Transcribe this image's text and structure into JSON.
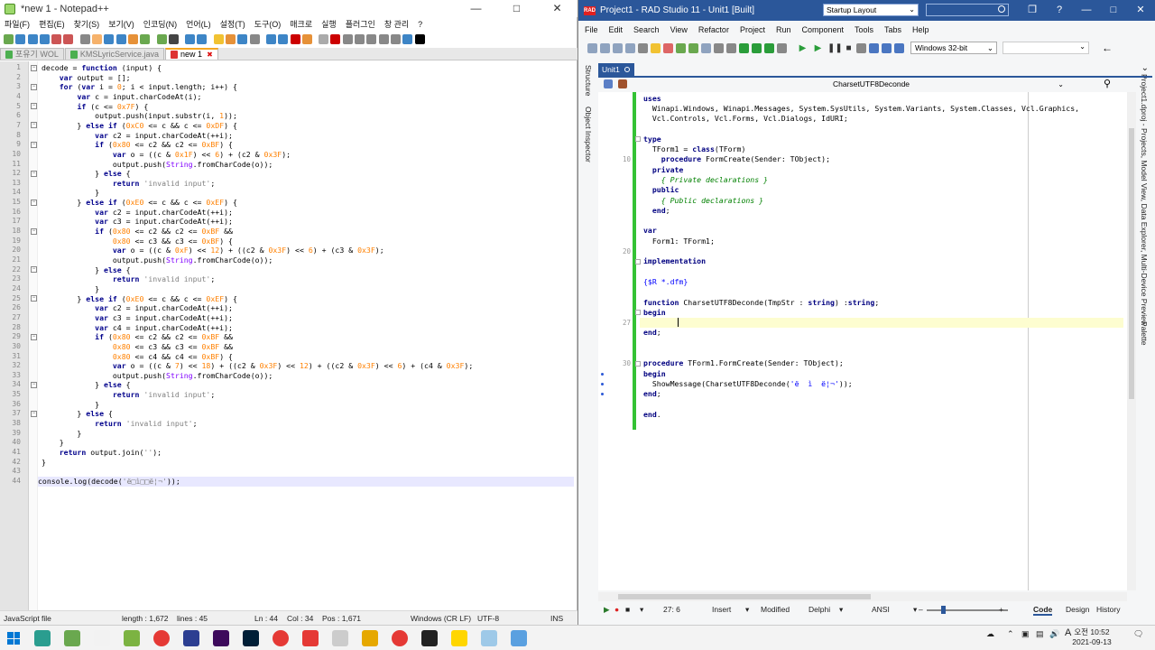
{
  "npp": {
    "title": "*new 1 - Notepad++",
    "menu": [
      "파일(F)",
      "편집(E)",
      "찾기(S)",
      "보기(V)",
      "인코딩(N)",
      "언어(L)",
      "설정(T)",
      "도구(O)",
      "매크로",
      "실행",
      "플러그인",
      "창 관리",
      "?"
    ],
    "tabs": [
      {
        "label": "포유기 WOL",
        "color": "#4caf50"
      },
      {
        "label": "KMSLyricService.java",
        "color": "#4caf50"
      },
      {
        "label": "new 1",
        "color": "#d33",
        "active": true
      }
    ],
    "code": [
      "decode = function (input) {",
      "    var output = [];",
      "    for (var i = 0; i < input.length; i++) {",
      "        var c = input.charCodeAt(i);",
      "        if (c <= 0x7F) {",
      "            output.push(input.substr(i, 1));",
      "        } else if (0xC0 <= c && c <= 0xDF) {",
      "            var c2 = input.charCodeAt(++i);",
      "            if (0x80 <= c2 && c2 <= 0xBF) {",
      "                var o = ((c & 0x1F) << 6) + (c2 & 0x3F);",
      "                output.push(String.fromCharCode(o));",
      "            } else {",
      "                return 'invalid input';",
      "            }",
      "        } else if (0xE0 <= c && c <= 0xEF) {",
      "            var c2 = input.charCodeAt(++i);",
      "            var c3 = input.charCodeAt(++i);",
      "            if (0x80 <= c2 && c2 <= 0xBF &&",
      "                0x80 <= c3 && c3 <= 0xBF) {",
      "                var o = ((c & 0xF) << 12) + ((c2 & 0x3F) << 6) + (c3 & 0x3F);",
      "                output.push(String.fromCharCode(o));",
      "            } else {",
      "                return 'invalid input';",
      "            }",
      "        } else if (0xE0 <= c && c <= 0xEF) {",
      "            var c2 = input.charCodeAt(++i);",
      "            var c3 = input.charCodeAt(++i);",
      "            var c4 = input.charCodeAt(++i);",
      "            if (0x80 <= c2 && c2 <= 0xBF &&",
      "                0x80 <= c3 && c3 <= 0xBF &&",
      "                0x80 <= c4 && c4 <= 0xBF) {",
      "                var o = ((c & 7) << 18) + ((c2 & 0x3F) << 12) + ((c2 & 0x3F) << 6) + (c4 & 0x3F);",
      "                output.push(String.fromCharCode(o));",
      "            } else {",
      "                return 'invalid input';",
      "            }",
      "        } else {",
      "            return 'invalid input';",
      "        }",
      "    }",
      "    return output.join('');",
      "}",
      "",
      "console.log(decode('ë□ì□□ë¦¬'));"
    ],
    "current_line": 44,
    "fold_lines": [
      1,
      3,
      5,
      7,
      9,
      12,
      15,
      18,
      22,
      25,
      29,
      34,
      37
    ],
    "status": {
      "lang": "JavaScript file",
      "length": "length : 1,672",
      "lines": "lines : 45",
      "ln": "Ln : 44",
      "col": "Col : 34",
      "pos": "Pos : 1,671",
      "eol": "Windows (CR LF)",
      "enc": "UTF-8",
      "ins": "INS"
    }
  },
  "rad": {
    "title": "Project1 - RAD Studio 11 - Unit1 [Built]",
    "layout": "Startup Layout",
    "menu": [
      "File",
      "Edit",
      "Search",
      "View",
      "Refactor",
      "Project",
      "Run",
      "Component",
      "Tools",
      "Tabs",
      "Help"
    ],
    "platform": "Windows 32-bit",
    "tab": "Unit1",
    "nav_selection": "CharsetUTF8Deconde",
    "side_left": [
      "Structure",
      "Object Inspector"
    ],
    "side_right": [
      "Project1.dproj - Projects, Model View, Data Explorer, Multi-Device Preview",
      "Palette"
    ],
    "code": [
      "uses",
      "  Winapi.Windows, Winapi.Messages, System.SysUtils, System.Variants, System.Classes, Vcl.Graphics,",
      "  Vcl.Controls, Vcl.Forms, Vcl.Dialogs, IdURI;",
      "",
      "type",
      "  TForm1 = class(TForm)",
      "    procedure FormCreate(Sender: TObject);",
      "  private",
      "    { Private declarations }",
      "  public",
      "    { Public declarations }",
      "  end;",
      "",
      "var",
      "  Form1: TForm1;",
      "",
      "implementation",
      "",
      "{$R *.dfm}",
      "",
      "function CharsetUTF8Deconde(TmpStr : string) :string;",
      "begin",
      "    |",
      "end;",
      "",
      "",
      "procedure TForm1.FormCreate(Sender: TObject);",
      "begin",
      "  ShowMessage(CharsetUTF8Deconde('ë  ì  ë¦¬'));",
      "end;",
      "",
      "end."
    ],
    "line_numbers": {
      "6": "10",
      "15": "20",
      "22": "27",
      "26": "30"
    },
    "dots": [
      28,
      29,
      30
    ],
    "folds": [
      4,
      16,
      21,
      26
    ],
    "status": {
      "pos": "27: 6",
      "mode": "Insert",
      "modified": "Modified",
      "lang": "Delphi",
      "enc": "ANSI",
      "code": "Code",
      "design": "Design",
      "history": "History"
    }
  },
  "taskbar": {
    "time": "오전 10:52",
    "date": "2021-09-13",
    "apps": [
      "#2a9d8f",
      "#6aa84f",
      "#f2f2f2",
      "#7cb342",
      "#e53935",
      "#2c3e91",
      "#3d0a5c",
      "#001e36",
      "#e53935",
      "#e53935",
      "#cccccc",
      "#e6a800",
      "#e53935",
      "#222222",
      "#ffd600",
      "#9ec9e8",
      "#5aa0e0"
    ]
  }
}
